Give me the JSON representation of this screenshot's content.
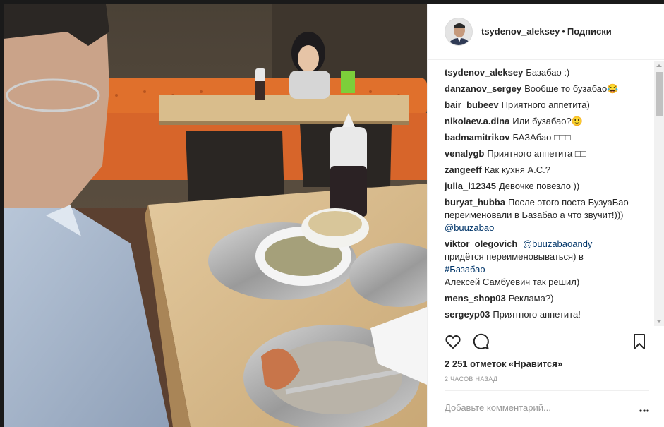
{
  "post": {
    "username": "tsydenov_aleksey",
    "separator": "•",
    "follow_status": "Подписки"
  },
  "comments": [
    {
      "user": "tsydenov_aleksey",
      "text": "Базабао :)"
    },
    {
      "user": "danzanov_sergey",
      "text": "Вообще то бузабао😂"
    },
    {
      "user": "bair_bubeev",
      "text": "Приятного аппетита)"
    },
    {
      "user": "nikolaev.a.dina",
      "text": "Или бузабао?🙂"
    },
    {
      "user": "badmamitrikov",
      "text": "БАЗАбао □□□"
    },
    {
      "user": "venalygb",
      "text": "Приятного аппетита □□"
    },
    {
      "user": "zangeeff",
      "text": "Как кухня А.С.?"
    },
    {
      "user": "julia_l12345",
      "text": "Девочке повезло ))"
    },
    {
      "user": "buryat_hubba",
      "text": "После этого поста БузуаБао переименовали в Базабао а что звучит!))) ",
      "link": "@buuzabao"
    },
    {
      "user": "viktor_olegovich",
      "link_first": "@buuzabaoandy",
      "text": "придётся переименовываться) в ",
      "hashtag": "#Базабао",
      "text2": "Алексей Самбуевич так решил)"
    },
    {
      "user": "mens_shop03",
      "text": "Реклама?)"
    },
    {
      "user": "sergeyp03",
      "text": "Приятного аппетита!"
    }
  ],
  "actions": {
    "likes": "2 251 отметок «Нравится»",
    "time": "2 часов назад"
  },
  "comment_box": {
    "placeholder": "Добавьте комментарий..."
  },
  "icons": {
    "like": "heart-icon",
    "comment": "comment-icon",
    "save": "bookmark-icon",
    "more": "more-icon"
  },
  "colors": {
    "text": "#262626",
    "link": "#003569",
    "muted": "#999999",
    "sofa": "#e0702c"
  }
}
